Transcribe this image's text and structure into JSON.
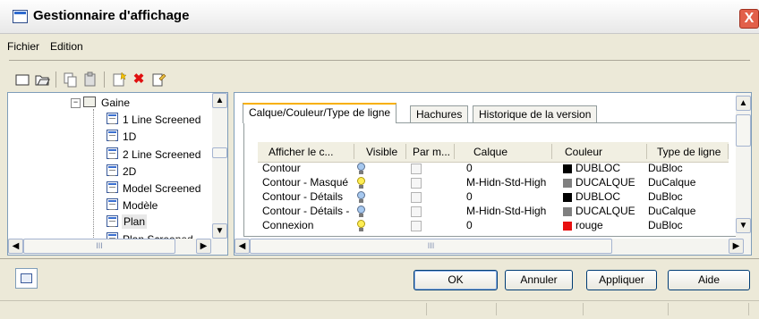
{
  "window": {
    "title": "Gestionnaire d'affichage",
    "close_glyph": "X"
  },
  "menu": [
    {
      "label": "Fichier"
    },
    {
      "label": "Edition"
    }
  ],
  "toolbar_icons": [
    "new-icon",
    "open-icon",
    "copy-icon",
    "paste-icon",
    "new-from-icon",
    "delete-icon",
    "rename-icon"
  ],
  "tree": {
    "items": [
      {
        "label": "Gaine"
      },
      {
        "label": "1 Line Screened"
      },
      {
        "label": "1D"
      },
      {
        "label": "2 Line Screened"
      },
      {
        "label": "2D"
      },
      {
        "label": "Model Screened"
      },
      {
        "label": "Modèle"
      },
      {
        "label": "Plan"
      },
      {
        "label": "Plan Screened"
      }
    ],
    "selected": "Plan",
    "hscroll_glyph": "III"
  },
  "tabs": [
    {
      "label": "Calque/Couleur/Type de ligne",
      "active": true
    },
    {
      "label": "Hachures",
      "active": false
    },
    {
      "label": "Historique de la version",
      "active": false
    }
  ],
  "grid": {
    "columns": [
      "Afficher le c...",
      "Visible",
      "Par m...",
      "Calque",
      "Couleur",
      "Type de ligne"
    ],
    "rows": [
      {
        "name": "Contour",
        "visible": "off",
        "layer": "0",
        "color_name": "DUBLOC",
        "color_hex": "#000000",
        "linetype": "DuBloc"
      },
      {
        "name": "Contour - Masqué",
        "visible": "on",
        "layer": "M-Hidn-Std-High",
        "color_name": "DUCALQUE",
        "color_hex": "#808080",
        "linetype": "DuCalque"
      },
      {
        "name": "Contour - Détails",
        "visible": "off",
        "layer": "0",
        "color_name": "DUBLOC",
        "color_hex": "#000000",
        "linetype": "DuBloc"
      },
      {
        "name": "Contour - Détails -",
        "visible": "off",
        "layer": "M-Hidn-Std-High",
        "color_name": "DUCALQUE",
        "color_hex": "#808080",
        "linetype": "DuCalque"
      },
      {
        "name": "Connexion",
        "visible": "on",
        "layer": "0",
        "color_name": "rouge",
        "color_hex": "#e81010",
        "linetype": "DuBloc"
      }
    ],
    "hscroll_glyph": "III"
  },
  "buttons": {
    "ok": "OK",
    "cancel": "Annuler",
    "apply": "Appliquer",
    "help": "Aide"
  },
  "colors": {
    "tab_active_accent": "#f8b000",
    "close_red": "#e2604a"
  }
}
